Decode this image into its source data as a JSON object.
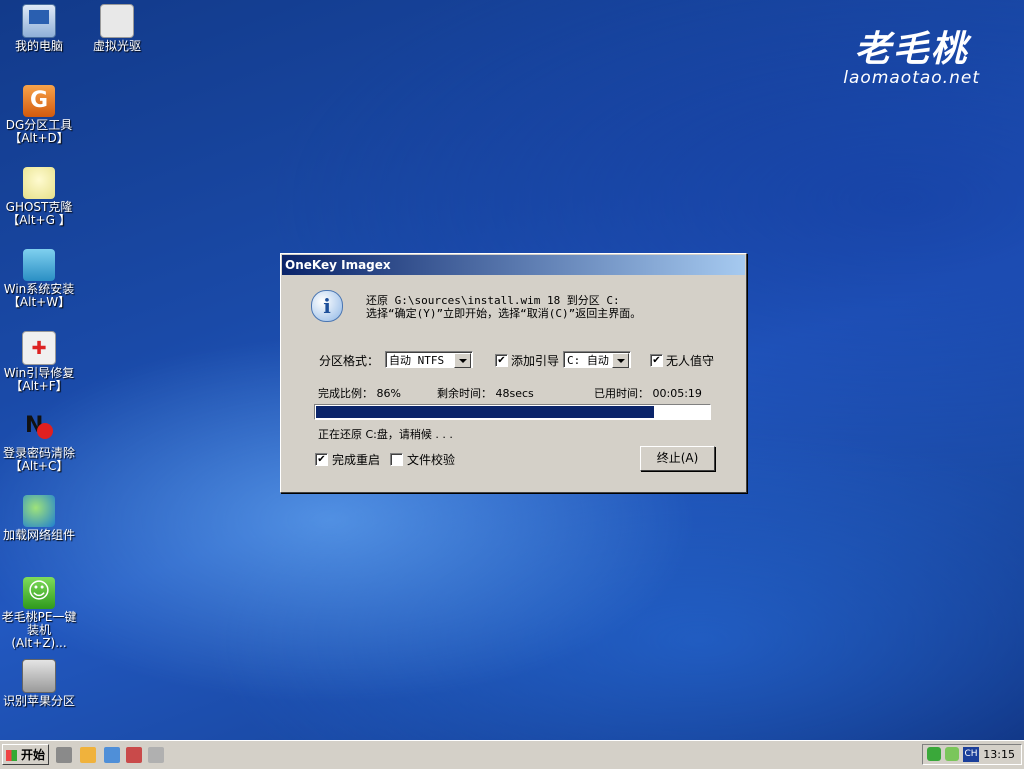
{
  "desktop": {
    "icons": [
      {
        "label": "我的电脑"
      },
      {
        "label": "虚拟光驱"
      },
      {
        "label": "DG分区工具\n【Alt+D】"
      },
      {
        "label": "GHOST克隆\n【Alt+G 】"
      },
      {
        "label": "Win系统安装\n【Alt+W】"
      },
      {
        "label": "Win引导修复\n【Alt+F】"
      },
      {
        "label": "登录密码清除\n【Alt+C】"
      },
      {
        "label": "加载网络组件"
      },
      {
        "label": "老毛桃PE一键\n装机(Alt+Z)..."
      },
      {
        "label": "识别苹果分区"
      }
    ],
    "brand": {
      "cn": "老毛桃",
      "en": "laomaotao.net"
    }
  },
  "dialog": {
    "title": "OneKey Imagex",
    "message_line1": "还原 G:\\sources\\install.wim 18 到分区 C:",
    "message_line2": "选择“确定(Y)”立即开始，选择“取消(C)”返回主界面。",
    "partition_format_label": "分区格式：",
    "partition_format_value": "自动 NTFS",
    "add_boot_label": "添加引导",
    "add_boot_checked": true,
    "boot_target_value": "C: 自动",
    "unattended_label": "无人值守",
    "unattended_checked": true,
    "progress_label": "完成比例： 86%",
    "remaining_label": "剩余时间： 48secs",
    "elapsed_label": "已用时间： 00:05:19",
    "progress_percent": 86,
    "status_text": "正在还原 C:盘，请稍候 . . .",
    "reboot_label": "完成重启",
    "reboot_checked": true,
    "verify_label": "文件校验",
    "verify_checked": false,
    "abort_button": "终止(A)"
  },
  "taskbar": {
    "start_label": "开始",
    "tray_lang": "CH",
    "clock": "13:15"
  }
}
